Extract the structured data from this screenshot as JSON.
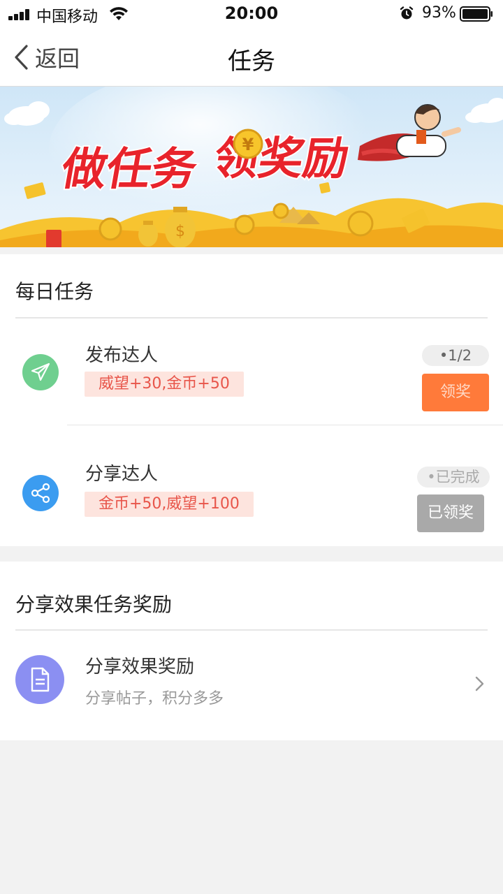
{
  "status_bar": {
    "carrier": "中国移动",
    "time": "20:00",
    "battery": "93%"
  },
  "nav": {
    "back_label": "返回",
    "title": "任务"
  },
  "banner": {
    "headline_left": "做任务",
    "headline_right": "领奖励",
    "coin_symbol": "¥"
  },
  "daily": {
    "title": "每日任务",
    "tasks": [
      {
        "name": "发布达人",
        "reward": "威望+30,金币+50",
        "progress": "•1/2",
        "button": "领奖",
        "icon": "paper-plane-icon",
        "icon_color": "#6fcf8f"
      },
      {
        "name": "分享达人",
        "reward": "金币+50,威望+100",
        "progress": "•已完成",
        "button": "已领奖",
        "icon": "share-icon",
        "icon_color": "#3b9cf0"
      }
    ]
  },
  "share_effect": {
    "title": "分享效果任务奖励",
    "item": {
      "name": "分享效果奖励",
      "subtitle": "分享帖子，积分多多",
      "icon": "document-icon",
      "icon_color": "#8b8ff2"
    }
  }
}
